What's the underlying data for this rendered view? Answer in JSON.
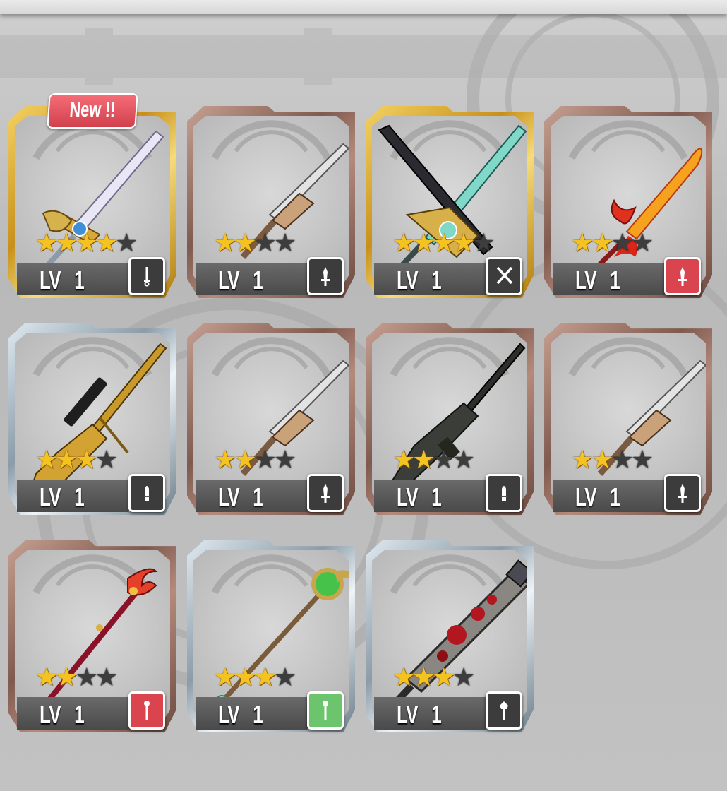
{
  "new_badge": "New !!",
  "colors": {
    "gold_frame": "#d8a82a",
    "bronze_frame": "#9c7466",
    "silver_frame": "#7d8e99",
    "type_dark": "#3c3c3c",
    "type_red": "#d9444e",
    "type_green": "#6cc46c",
    "star_on": "#f4c320",
    "star_off": "#3d3d3d"
  },
  "items": [
    {
      "rarity": "gold",
      "stars": 4,
      "max_stars": 5,
      "level_label": "LV",
      "level": "1",
      "type_color": "dark",
      "type_icon": "sword-type-icon",
      "weapon": "longsword-icon",
      "is_new": true
    },
    {
      "rarity": "bronze",
      "stars": 2,
      "max_stars": 4,
      "level_label": "LV",
      "level": "1",
      "type_color": "dark",
      "type_icon": "dagger-type-icon",
      "weapon": "dagger-icon",
      "is_new": false
    },
    {
      "rarity": "gold",
      "stars": 4,
      "max_stars": 5,
      "level_label": "LV",
      "level": "1",
      "type_color": "dark",
      "type_icon": "dual-swords-type-icon",
      "weapon": "twin-swords-icon",
      "is_new": false
    },
    {
      "rarity": "bronze",
      "stars": 2,
      "max_stars": 4,
      "level_label": "LV",
      "level": "1",
      "type_color": "red",
      "type_icon": "dagger-type-icon",
      "weapon": "flame-sword-icon",
      "is_new": false
    },
    {
      "rarity": "silver",
      "stars": 3,
      "max_stars": 4,
      "level_label": "LV",
      "level": "1",
      "type_color": "dark",
      "type_icon": "bullet-type-icon",
      "weapon": "sniper-rifle-icon",
      "is_new": false
    },
    {
      "rarity": "bronze",
      "stars": 2,
      "max_stars": 4,
      "level_label": "LV",
      "level": "1",
      "type_color": "dark",
      "type_icon": "dagger-type-icon",
      "weapon": "dagger-icon",
      "is_new": false
    },
    {
      "rarity": "bronze",
      "stars": 2,
      "max_stars": 4,
      "level_label": "LV",
      "level": "1",
      "type_color": "dark",
      "type_icon": "bullet-type-icon",
      "weapon": "rifle-icon",
      "is_new": false
    },
    {
      "rarity": "bronze",
      "stars": 2,
      "max_stars": 4,
      "level_label": "LV",
      "level": "1",
      "type_color": "dark",
      "type_icon": "dagger-type-icon",
      "weapon": "dagger-icon",
      "is_new": false
    },
    {
      "rarity": "bronze",
      "stars": 2,
      "max_stars": 4,
      "level_label": "LV",
      "level": "1",
      "type_color": "red",
      "type_icon": "staff-type-icon",
      "weapon": "fire-staff-icon",
      "is_new": false
    },
    {
      "rarity": "silver",
      "stars": 3,
      "max_stars": 4,
      "level_label": "LV",
      "level": "1",
      "type_color": "green",
      "type_icon": "staff-type-icon",
      "weapon": "emerald-staff-icon",
      "is_new": false
    },
    {
      "rarity": "silver",
      "stars": 3,
      "max_stars": 4,
      "level_label": "LV",
      "level": "1",
      "type_color": "dark",
      "type_icon": "mace-type-icon",
      "weapon": "bloody-club-icon",
      "is_new": false
    }
  ]
}
